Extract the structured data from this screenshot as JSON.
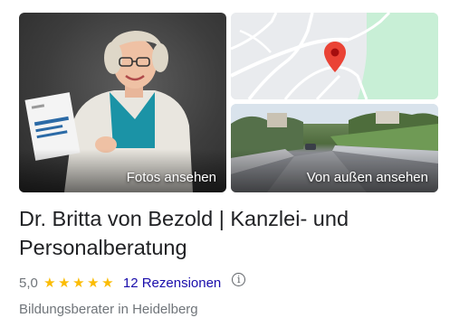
{
  "tiles": {
    "photos_label": "Fotos ansehen",
    "outside_label": "Von außen ansehen"
  },
  "book_cover_icon": "book-cover",
  "map_pin_color": "#ea4335",
  "business": {
    "name": "Dr. Britta von Bezold | Kanzlei- und Personalberatung",
    "rating": "5,0",
    "star_count": 5,
    "star_color": "#fbbc04",
    "reviews": "12 Rezensionen",
    "info_icon": "info-icon",
    "category": "Bildungsberater in Heidelberg"
  }
}
